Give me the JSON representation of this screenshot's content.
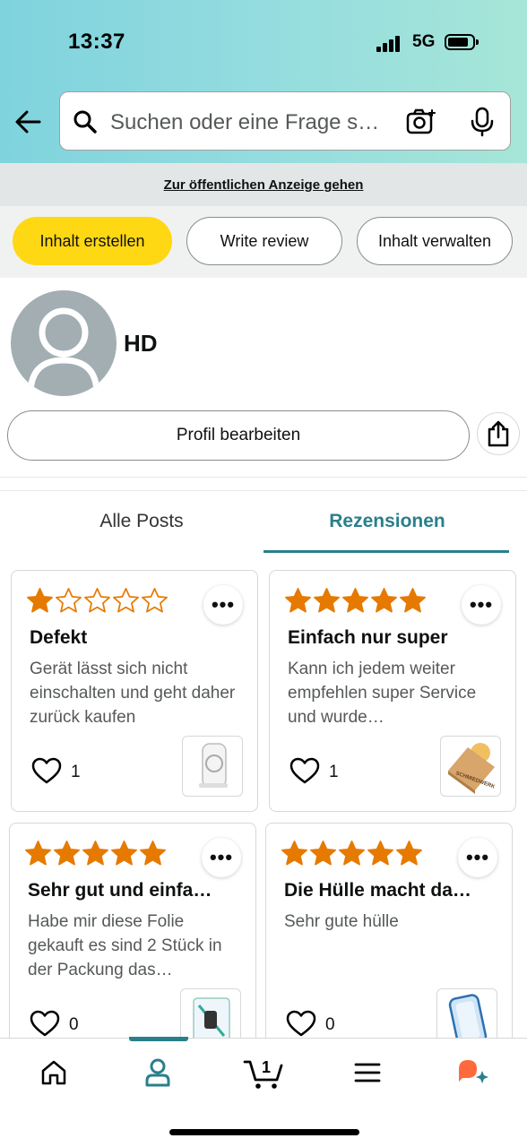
{
  "status_bar": {
    "time": "13:37",
    "network": "5G"
  },
  "search": {
    "placeholder": "Suchen oder eine Frage s…"
  },
  "public_link": "Zur öffentlichen Anzeige gehen",
  "action_pills": [
    "Inhalt erstellen",
    "Write review",
    "Inhalt verwalten"
  ],
  "profile": {
    "name": "HD",
    "edit_label": "Profil bearbeiten"
  },
  "tabs": [
    {
      "label": "Alle Posts",
      "active": false
    },
    {
      "label": "Rezensionen",
      "active": true
    }
  ],
  "reviews": [
    {
      "rating": 1,
      "title": "Defekt",
      "body": "Gerät lässt sich nicht einschalten und geht daher zurück kaufen",
      "likes": "1",
      "thumb": "magsafe-powerbank"
    },
    {
      "rating": 5,
      "title": "Einfach nur super",
      "body": "Kann ich jedem weiter empfehlen super Service und wurde…",
      "likes": "1",
      "thumb": "schmiedwerk-board"
    },
    {
      "rating": 5,
      "title": "Sehr gut und einfa…",
      "body": "Habe mir diese Folie gekauft es sind 2 Stück in der Packung das…",
      "likes": "0",
      "thumb": "screen-protector"
    },
    {
      "rating": 5,
      "title": "Die Hülle macht da…",
      "body": "Sehr gute hülle",
      "likes": "0",
      "thumb": "phone-case"
    }
  ],
  "thumb_labels": {
    "board": "SCHMIEDWERK"
  },
  "bottom_nav": {
    "items": [
      "home-icon",
      "profile-icon",
      "cart-icon",
      "menu-icon",
      "rufus-icon"
    ],
    "active": "profile-icon",
    "cart_count": "1"
  },
  "colors": {
    "accent": "#2a7f8c",
    "star": "#e67a00",
    "primary_button": "#ffd814"
  }
}
